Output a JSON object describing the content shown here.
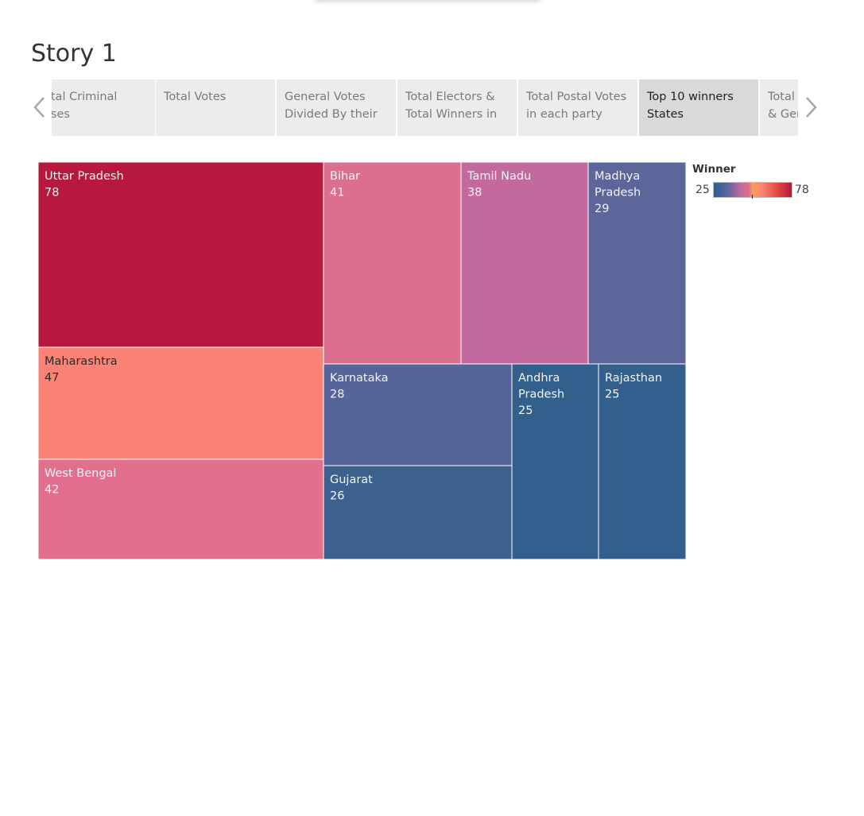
{
  "story": {
    "title": "Story 1"
  },
  "tabs": [
    {
      "label": "Total Criminal Cases",
      "visible_text": "otal Criminal\nases",
      "active": false
    },
    {
      "label": "Total Votes",
      "visible_text": "Total Votes",
      "active": false
    },
    {
      "label": "General Votes Divided By their Education",
      "visible_text": "General Votes\nDivided By their",
      "active": false
    },
    {
      "label": "Total Electors & Total Winners in each Constituency",
      "visible_text": "Total Electors &\nTotal Winners in",
      "active": false
    },
    {
      "label": "Total Postal Votes in each party",
      "visible_text": "Total Postal Votes\nin each party",
      "active": false
    },
    {
      "label": "Top 10 winners States",
      "visible_text": "Top 10 winners\nStates",
      "active": true
    },
    {
      "label": "Total Winners & Gender",
      "visible_text": "Total\n& Gen",
      "active": false
    }
  ],
  "legend": {
    "title": "Winner",
    "min_label": "25",
    "max_label": "78"
  },
  "colors": {
    "scale_low": "#2f5e8e",
    "scale_mid_low": "#5a66a0",
    "scale_mid": "#c46a9e",
    "scale_mid_high": "#e06e8c",
    "scale_high": "#b8173e",
    "salmon": "#fa8375"
  },
  "chart_data": {
    "type": "treemap",
    "title": "",
    "measure": "Winner",
    "items": [
      {
        "state": "Uttar Pradesh",
        "value": 78,
        "color": "#b8183e",
        "dark_text": false
      },
      {
        "state": "Maharashtra",
        "value": 47,
        "color": "#fa8375",
        "dark_text": true
      },
      {
        "state": "West Bengal",
        "value": 42,
        "color": "#e36f8f",
        "dark_text": false
      },
      {
        "state": "Bihar",
        "value": 41,
        "color": "#dc6e90",
        "dark_text": false
      },
      {
        "state": "Tamil Nadu",
        "value": 38,
        "color": "#c3699d",
        "dark_text": false
      },
      {
        "state": "Madhya Pradesh",
        "value": 29,
        "color": "#5c669b",
        "dark_text": false
      },
      {
        "state": "Karnataka",
        "value": 28,
        "color": "#55659a",
        "dark_text": false
      },
      {
        "state": "Gujarat",
        "value": 26,
        "color": "#3d618f",
        "dark_text": false
      },
      {
        "state": "Andhra Pradesh",
        "value": 25,
        "color": "#335f8c",
        "dark_text": false
      },
      {
        "state": "Rajasthan",
        "value": 25,
        "color": "#335f8c",
        "dark_text": false
      }
    ]
  }
}
